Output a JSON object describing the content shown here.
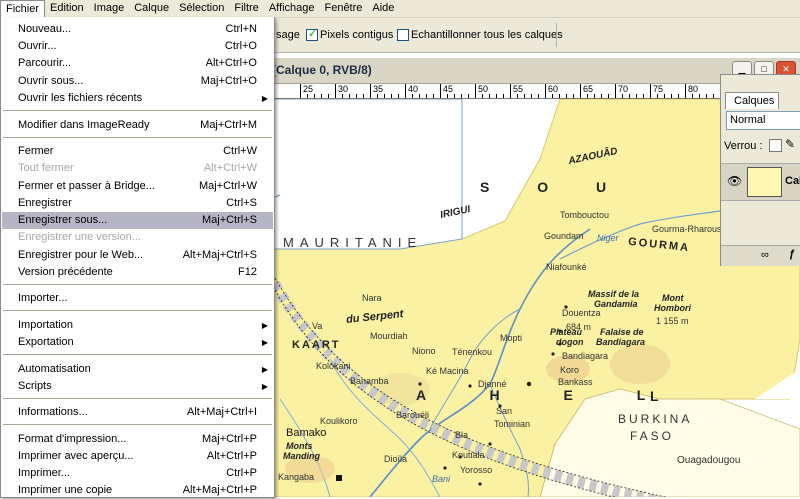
{
  "menubar": [
    "Fichier",
    "Edition",
    "Image",
    "Calque",
    "Sélection",
    "Filtre",
    "Affichage",
    "Fenêtre",
    "Aide"
  ],
  "options": {
    "partial_label": "sage",
    "pixels_contigus": "Pixels contigus",
    "echantillonner": "Echantillonner tous les calques"
  },
  "document": {
    "title": "(Calque 0, RVB/8)",
    "ruler": [
      "25",
      "30",
      "35",
      "40",
      "45",
      "50",
      "55",
      "60",
      "65",
      "70",
      "75",
      "80",
      "85"
    ]
  },
  "menu": {
    "items": [
      {
        "label": "Nouveau...",
        "shortcut": "Ctrl+N"
      },
      {
        "label": "Ouvrir...",
        "shortcut": "Ctrl+O"
      },
      {
        "label": "Parcourir...",
        "shortcut": "Alt+Ctrl+O"
      },
      {
        "label": "Ouvrir sous...",
        "shortcut": "Maj+Ctrl+O"
      },
      {
        "label": "Ouvrir les fichiers récents",
        "shortcut": "",
        "submenu": true
      },
      {
        "label": "Modifier dans ImageReady",
        "shortcut": "Maj+Ctrl+M"
      },
      {
        "label": "Fermer",
        "shortcut": "Ctrl+W"
      },
      {
        "label": "Tout fermer",
        "shortcut": "Alt+Ctrl+W",
        "disabled": true
      },
      {
        "label": "Fermer et passer à Bridge...",
        "shortcut": "Maj+Ctrl+W"
      },
      {
        "label": "Enregistrer",
        "shortcut": "Ctrl+S"
      },
      {
        "label": "Enregistrer sous...",
        "shortcut": "Maj+Ctrl+S",
        "highlighted": true
      },
      {
        "label": "Enregistrer une version...",
        "shortcut": "",
        "disabled": true
      },
      {
        "label": "Enregistrer pour le Web...",
        "shortcut": "Alt+Maj+Ctrl+S"
      },
      {
        "label": "Version précédente",
        "shortcut": "F12"
      },
      {
        "label": "Importer...",
        "shortcut": ""
      },
      {
        "label": "Importation",
        "shortcut": "",
        "submenu": true
      },
      {
        "label": "Exportation",
        "shortcut": "",
        "submenu": true
      },
      {
        "label": "Automatisation",
        "shortcut": "",
        "submenu": true
      },
      {
        "label": "Scripts",
        "shortcut": "",
        "submenu": true
      },
      {
        "label": "Informations...",
        "shortcut": "Alt+Maj+Ctrl+I"
      },
      {
        "label": "Format d'impression...",
        "shortcut": "Maj+Ctrl+P"
      },
      {
        "label": "Imprimer avec aperçu...",
        "shortcut": "Alt+Ctrl+P"
      },
      {
        "label": "Imprimer...",
        "shortcut": "Ctrl+P"
      },
      {
        "label": "Imprimer une copie",
        "shortcut": "Alt+Maj+Ctrl+P"
      }
    ]
  },
  "layers": {
    "tab": "Calques",
    "blend_mode": "Normal",
    "lock_label": "Verrou :",
    "layer_name": "Cal"
  },
  "map": {
    "labels": {
      "sou": "S O U",
      "azaouad": "AZAOUÂD",
      "irigui": "IRIGUI",
      "mauritanie": "MAURITANIE",
      "tombouctou": "Tombouctou",
      "goundam": "Goundam",
      "gourma_rharous": "Gourma-Rharous",
      "niger": "Niger",
      "gourma": "GOURMA",
      "niafounke": "Niafounké",
      "massif": "Massif de la",
      "gandamia": "Gandamia",
      "hombori_mont": "Mont",
      "hombori": "Hombori",
      "hombori_alt": "1 155 m",
      "douentza": "Douentza",
      "plateau": "Plateau",
      "dogon": "dogon",
      "falaise": "Falaise de",
      "bandiagara_f": "Bandiagara",
      "alt_684": "684 m",
      "mopti": "Mopti",
      "bandiagara": "Bandiagara",
      "bankass": "Bankass",
      "koro": "Koro",
      "tenenkou": "Ténenkou",
      "niono": "Niono",
      "macina": "Ké Macina",
      "djenne": "Djenné",
      "san": "San",
      "tominian": "Tominian",
      "nara": "Nara",
      "serpent": "du Serpent",
      "va": "Va",
      "mourdiah": "Mourdiah",
      "kaarta": "KAART",
      "kolokani": "Kolokani",
      "banamba": "Banamba",
      "sahel": "A H E L",
      "koulikoro": "Koulikoro",
      "bamako": "Bamako",
      "monts": "Monts",
      "manding": "Manding",
      "barouéli": "Barouéli",
      "bla": "Bla",
      "dioila": "Dioïla",
      "koutiala": "Koutiala",
      "yorosso": "Yorosso",
      "burkina": "BURKINA",
      "faso": "FASO",
      "ouagadougou": "Ouagadougou",
      "letter_l": "L",
      "kangaba": "Kangaba",
      "bani": "Bani"
    }
  }
}
